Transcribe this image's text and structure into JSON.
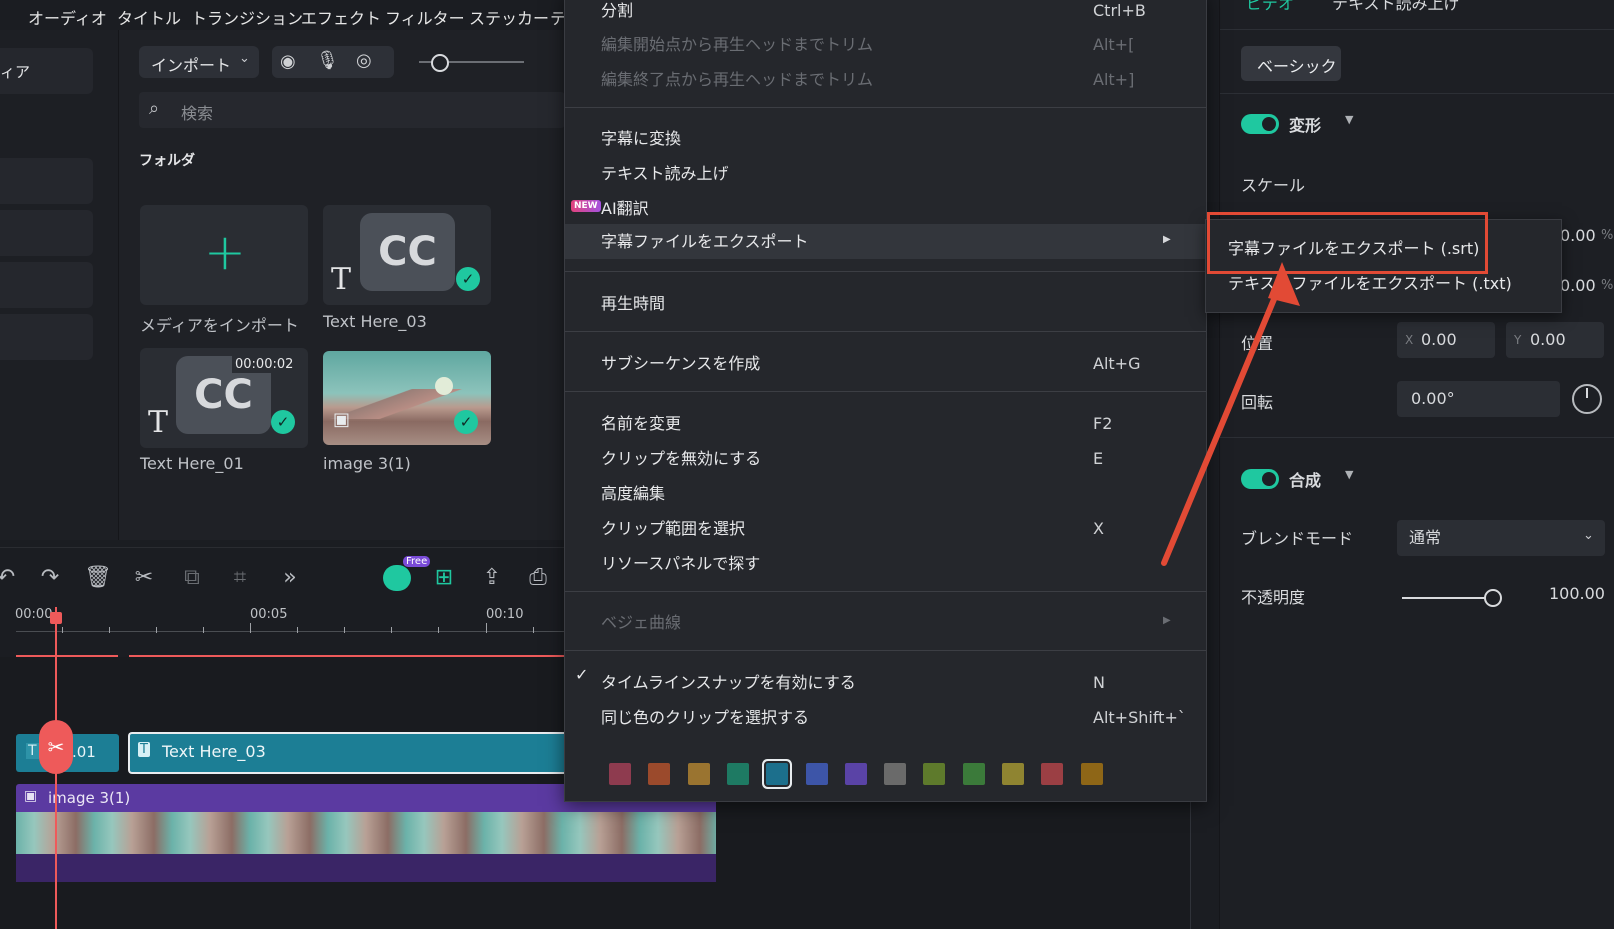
{
  "top_menu": [
    "オーディオ",
    "タイトル",
    "トランジション",
    "エフェクト",
    "フィルター",
    "ステッカー",
    "テ"
  ],
  "left_panel": {
    "first_label": "ィア"
  },
  "media": {
    "import_dropdown": "インポート",
    "search_placeholder": "検索",
    "folder_label": "フォルダ",
    "items": [
      {
        "caption": "メディアをインポート"
      },
      {
        "caption": "Text Here_03"
      },
      {
        "caption": "Text Here_01",
        "duration": "00:00:02"
      },
      {
        "caption": "image 3(1)"
      }
    ],
    "cc_text": "CC"
  },
  "timeline": {
    "free_badge": "Free",
    "ruler_labels": [
      "00:00",
      "00:05",
      "00:10"
    ],
    "clip_text_left": ".01",
    "clip_text_main": "Text Here_03",
    "clip_image": "image 3(1)"
  },
  "context_menu": {
    "items": [
      {
        "label": "分割",
        "shortcut": "Ctrl+B"
      },
      {
        "label": "編集開始点から再生ヘッドまでトリム",
        "shortcut": "Alt+[",
        "disabled": true
      },
      {
        "label": "編集終了点から再生ヘッドまでトリム",
        "shortcut": "Alt+]",
        "disabled": true
      },
      {
        "label": "字幕に変換"
      },
      {
        "label": "テキスト読み上げ"
      },
      {
        "label": "AI翻訳",
        "badge": "NEW"
      },
      {
        "label": "字幕ファイルをエクスポート",
        "submenu": true
      },
      {
        "label": "再生時間"
      },
      {
        "label": "サブシーケンスを作成",
        "shortcut": "Alt+G"
      },
      {
        "label": "名前を変更",
        "shortcut": "F2"
      },
      {
        "label": "クリップを無効にする",
        "shortcut": "E"
      },
      {
        "label": "高度編集"
      },
      {
        "label": "クリップ範囲を選択",
        "shortcut": "X"
      },
      {
        "label": "リソースパネルで探す"
      },
      {
        "label": "ベジェ曲線",
        "disabled": true,
        "submenu": true
      },
      {
        "label": "タイムラインスナップを有効にする",
        "shortcut": "N",
        "checked": true
      },
      {
        "label": "同じ色のクリップを選択する",
        "shortcut": "Alt+Shift+`"
      }
    ],
    "colors": [
      "#8e3b4f",
      "#9b4a2c",
      "#9a7430",
      "#1e7a63",
      "#1c6f8c",
      "#3d55a8",
      "#5a43a6",
      "#6a6a6a",
      "#5e7a2c",
      "#3b7a3a",
      "#8f8431",
      "#9b3f44",
      "#8e6617"
    ],
    "selected_color_index": 4
  },
  "submenu": {
    "items": [
      "字幕ファイルをエクスポート (.srt)",
      "テキストファイルをエクスポート (.txt)"
    ],
    "highlight_color": "#e24a35"
  },
  "right_panel": {
    "tab_left": "ビデオ",
    "tab_right": "テキスト読み上げ",
    "basic_button": "ベーシック",
    "transform_label": "変形",
    "scale_label": "スケール",
    "scale_x_value": "0.00",
    "scale_y_value": "0.00",
    "percent": "%",
    "position_label": "位置",
    "pos_x_prefix": "X",
    "pos_x": "0.00",
    "pos_y_prefix": "Y",
    "pos_y": "0.00",
    "rotation_label": "回転",
    "rotation_value": "0.00°",
    "composite_label": "合成",
    "blend_label": "ブレンドモード",
    "blend_value": "通常",
    "opacity_label": "不透明度",
    "opacity_value": "100.00",
    "opacity_fraction": 1.0
  },
  "accent_color": "#1fc8a0"
}
